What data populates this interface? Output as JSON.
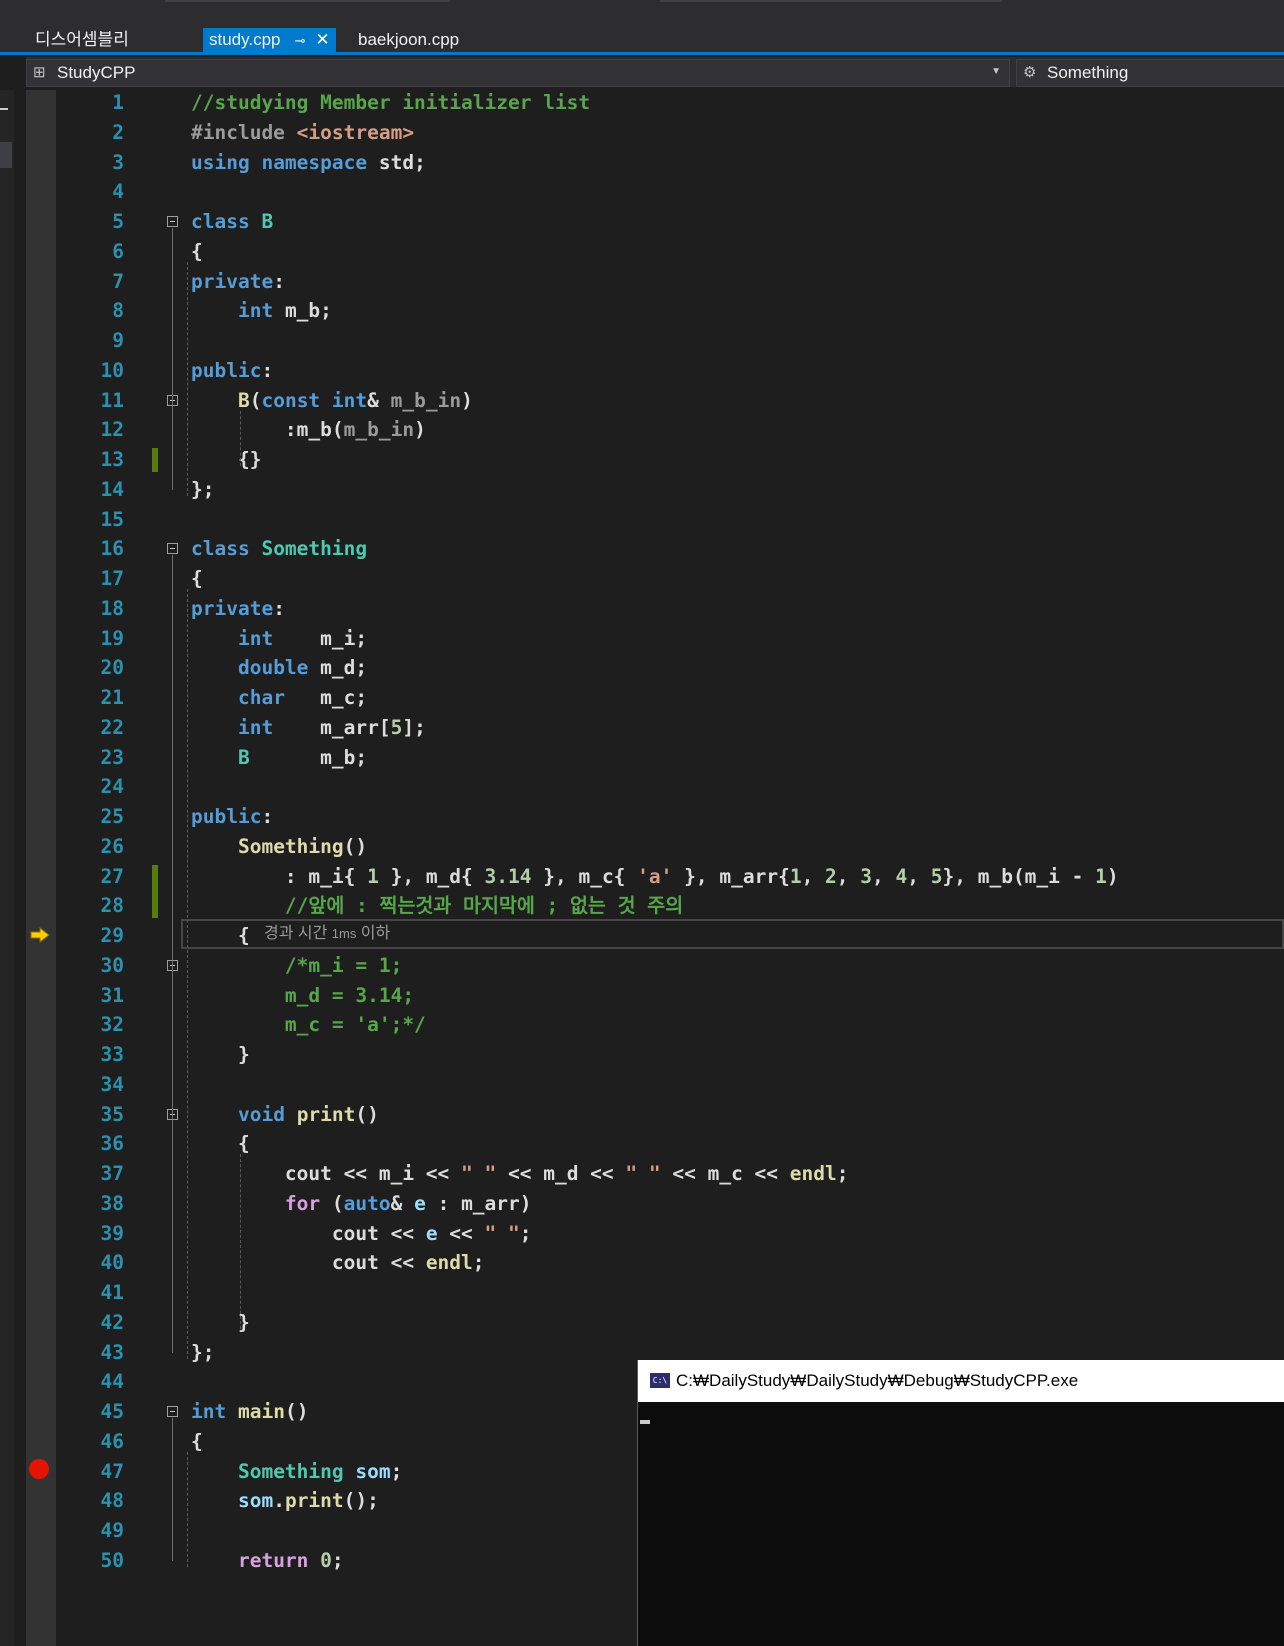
{
  "tabs": {
    "left": "디스어셈블리",
    "active": "study.cpp",
    "other": "baekjoon.cpp"
  },
  "navbar": {
    "scope": "StudyCPP",
    "member": "Something"
  },
  "perf_tip": {
    "prefix": "경과 시간",
    "value": "1ms",
    "suffix": "이하"
  },
  "console": {
    "title": "C:₩DailyStudy₩DailyStudy₩Debug₩StudyCPP.exe"
  },
  "editor": {
    "line_numbers": [
      "1",
      "2",
      "3",
      "4",
      "5",
      "6",
      "7",
      "8",
      "9",
      "10",
      "11",
      "12",
      "13",
      "14",
      "15",
      "16",
      "17",
      "18",
      "19",
      "20",
      "21",
      "22",
      "23",
      "24",
      "25",
      "26",
      "27",
      "28",
      "29",
      "30",
      "31",
      "32",
      "33",
      "34",
      "35",
      "36",
      "37",
      "38",
      "39",
      "40",
      "41",
      "42",
      "43",
      "44",
      "45",
      "46",
      "47",
      "48",
      "49",
      "50"
    ],
    "lines": [
      [
        [
          "cm",
          "//studying Member initializer list"
        ]
      ],
      [
        [
          "pp",
          "#include "
        ],
        [
          "st",
          "<iostream>"
        ]
      ],
      [
        [
          "kw",
          "using"
        ],
        [
          "",
          " "
        ],
        [
          "kw",
          "namespace"
        ],
        [
          "",
          " std;"
        ]
      ],
      [],
      [
        [
          "kw",
          "class"
        ],
        [
          "",
          " "
        ],
        [
          "ty",
          "B"
        ]
      ],
      [
        [
          "",
          "{"
        ]
      ],
      [
        [
          "kw",
          "private"
        ],
        [
          "",
          ":"
        ]
      ],
      [
        [
          "",
          "    "
        ],
        [
          "kw",
          "int"
        ],
        [
          "",
          " m_b;"
        ]
      ],
      [],
      [
        [
          "kw",
          "public"
        ],
        [
          "",
          ":"
        ]
      ],
      [
        [
          "",
          "    "
        ],
        [
          "fn",
          "B"
        ],
        [
          "",
          "("
        ],
        [
          "kw",
          "const"
        ],
        [
          "",
          " "
        ],
        [
          "kw",
          "int"
        ],
        [
          "",
          "& "
        ],
        [
          "pa",
          "m_b_in"
        ],
        [
          "",
          ")"
        ]
      ],
      [
        [
          "",
          "        :m_b("
        ],
        [
          "pa",
          "m_b_in"
        ],
        [
          "",
          ")"
        ]
      ],
      [
        [
          "",
          "    {}"
        ]
      ],
      [
        [
          "",
          "};"
        ]
      ],
      [],
      [
        [
          "kw",
          "class"
        ],
        [
          "",
          " "
        ],
        [
          "ty",
          "Something"
        ]
      ],
      [
        [
          "",
          "{"
        ]
      ],
      [
        [
          "kw",
          "private"
        ],
        [
          "",
          ":"
        ]
      ],
      [
        [
          "",
          "    "
        ],
        [
          "kw",
          "int"
        ],
        [
          "",
          "    m_i;"
        ]
      ],
      [
        [
          "",
          "    "
        ],
        [
          "kw",
          "double"
        ],
        [
          "",
          " m_d;"
        ]
      ],
      [
        [
          "",
          "    "
        ],
        [
          "kw",
          "char"
        ],
        [
          "",
          "   m_c;"
        ]
      ],
      [
        [
          "",
          "    "
        ],
        [
          "kw",
          "int"
        ],
        [
          "",
          "    m_arr["
        ],
        [
          "nm",
          "5"
        ],
        [
          "",
          "];"
        ]
      ],
      [
        [
          "",
          "    "
        ],
        [
          "ty",
          "B"
        ],
        [
          "",
          "      m_b;"
        ]
      ],
      [],
      [
        [
          "kw",
          "public"
        ],
        [
          "",
          ":"
        ]
      ],
      [
        [
          "",
          "    "
        ],
        [
          "fn",
          "Something"
        ],
        [
          "",
          "()"
        ]
      ],
      [
        [
          "",
          "        : m_i{ "
        ],
        [
          "nm",
          "1"
        ],
        [
          "",
          " }, m_d{ "
        ],
        [
          "nm",
          "3.14"
        ],
        [
          "",
          " }, m_c{ "
        ],
        [
          "st",
          "'a'"
        ],
        [
          "",
          " }, m_arr{"
        ],
        [
          "nm",
          "1"
        ],
        [
          "",
          ", "
        ],
        [
          "nm",
          "2"
        ],
        [
          "",
          ", "
        ],
        [
          "nm",
          "3"
        ],
        [
          "",
          ", "
        ],
        [
          "nm",
          "4"
        ],
        [
          "",
          ", "
        ],
        [
          "nm",
          "5"
        ],
        [
          "",
          "}, m_b(m_i - "
        ],
        [
          "nm",
          "1"
        ],
        [
          "",
          ")"
        ]
      ],
      [
        [
          "",
          "        "
        ],
        [
          "cm",
          "//앞에 : 찍는것과 마지막에 ; 없는 것 주의"
        ]
      ],
      [
        [
          "",
          "    {"
        ]
      ],
      [
        [
          "",
          "        "
        ],
        [
          "cm",
          "/*m_i = 1;"
        ]
      ],
      [
        [
          "",
          "        "
        ],
        [
          "cm",
          "m_d = 3.14;"
        ]
      ],
      [
        [
          "",
          "        "
        ],
        [
          "cm",
          "m_c = 'a';*/"
        ]
      ],
      [
        [
          "",
          "    }"
        ]
      ],
      [],
      [
        [
          "",
          "    "
        ],
        [
          "kw",
          "void"
        ],
        [
          "",
          " "
        ],
        [
          "fn",
          "print"
        ],
        [
          "",
          "()"
        ]
      ],
      [
        [
          "",
          "    {"
        ]
      ],
      [
        [
          "",
          "        cout << m_i << "
        ],
        [
          "st",
          "\" \""
        ],
        [
          "",
          " << m_d << "
        ],
        [
          "st",
          "\" \""
        ],
        [
          "",
          " << m_c << "
        ],
        [
          "fn",
          "endl"
        ],
        [
          "",
          ";"
        ]
      ],
      [
        [
          "",
          "        "
        ],
        [
          "fl",
          "for"
        ],
        [
          "",
          " ("
        ],
        [
          "kw",
          "auto"
        ],
        [
          "",
          "& "
        ],
        [
          "lo",
          "e"
        ],
        [
          "",
          " : m_arr)"
        ]
      ],
      [
        [
          "",
          "            cout << "
        ],
        [
          "lo",
          "e"
        ],
        [
          "",
          " << "
        ],
        [
          "st",
          "\" \""
        ],
        [
          "",
          ";"
        ]
      ],
      [
        [
          "",
          "            cout << "
        ],
        [
          "fn",
          "endl"
        ],
        [
          "",
          ";"
        ]
      ],
      [],
      [
        [
          "",
          "    }"
        ]
      ],
      [
        [
          "",
          "};"
        ]
      ],
      [],
      [
        [
          "kw",
          "int"
        ],
        [
          "",
          " "
        ],
        [
          "fn",
          "main"
        ],
        [
          "",
          "()"
        ]
      ],
      [
        [
          "",
          "{"
        ]
      ],
      [
        [
          "",
          "    "
        ],
        [
          "ty",
          "Something"
        ],
        [
          "",
          " "
        ],
        [
          "lo",
          "som"
        ],
        [
          "",
          ";"
        ]
      ],
      [
        [
          "",
          "    "
        ],
        [
          "lo",
          "som"
        ],
        [
          "",
          "."
        ],
        [
          "fn",
          "print"
        ],
        [
          "",
          "();"
        ]
      ],
      [],
      [
        [
          "",
          "    "
        ],
        [
          "fl",
          "return"
        ],
        [
          "",
          " "
        ],
        [
          "nm",
          "0"
        ],
        [
          "",
          ";"
        ]
      ]
    ]
  }
}
